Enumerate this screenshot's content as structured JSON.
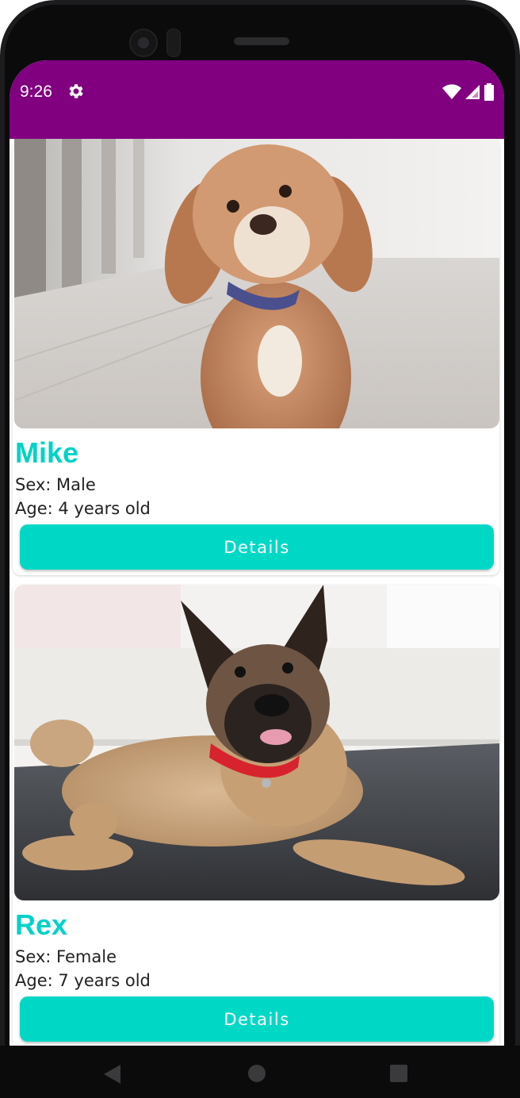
{
  "status_bar": {
    "time": "9:26",
    "settings_icon": "gear-icon",
    "wifi_icon": "wifi-icon",
    "signal_icon": "cell-signal-icon",
    "battery_icon": "battery-icon",
    "background": "#800080"
  },
  "pets": [
    {
      "name": "Mike",
      "sex": "Sex: Male",
      "age": "Age: 4 years old",
      "details_label": "Details"
    },
    {
      "name": "Rex",
      "sex": "Sex: Female",
      "age": "Age: 7 years old",
      "details_label": "Details"
    }
  ],
  "colors": {
    "accent": "#00d8c6",
    "name_color": "#00d2c8"
  },
  "nav_bar": {
    "back_icon": "back-triangle-icon",
    "home_icon": "home-circle-icon",
    "recents_icon": "recents-square-icon"
  }
}
